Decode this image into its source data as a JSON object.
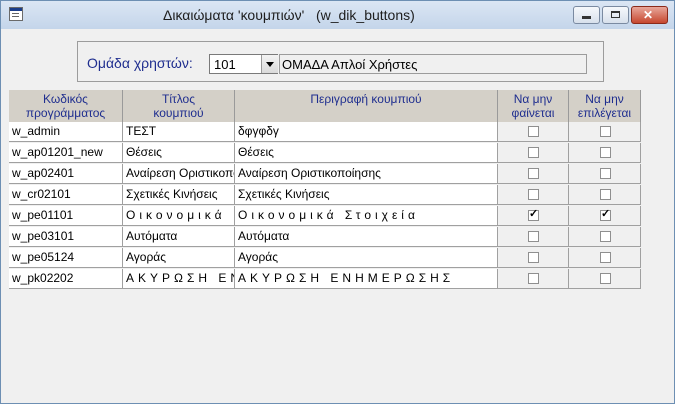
{
  "window": {
    "title": "Δικαιώματα 'κουμπιών'   (w_dik_buttons)",
    "accent": "#1f2e8f"
  },
  "header": {
    "group_label": "Ομάδα χρηστών:",
    "group_code": "101",
    "group_description": "ΟΜΑΔΑ Απλοί Χρήστες"
  },
  "columns": [
    {
      "line1": "Κωδικός",
      "line2": "προγράμματος"
    },
    {
      "line1": "Τίτλος",
      "line2": "κουμπιού"
    },
    {
      "line1": "Περιγραφή κουμπιού",
      "line2": ""
    },
    {
      "line1": "Να μην",
      "line2": "φαίνεται"
    },
    {
      "line1": "Να μην",
      "line2": "επιλέγεται"
    }
  ],
  "rows": [
    {
      "code": "w_admin",
      "title": "ΤΕΣΤ",
      "description": "δφγφδγ",
      "hidden": false,
      "disabled": false,
      "spaced": false
    },
    {
      "code": "w_ap01201_new",
      "title": "Θέσεις",
      "description": "Θέσεις",
      "hidden": false,
      "disabled": false,
      "spaced": false
    },
    {
      "code": "w_ap02401",
      "title": "Αναίρεση Οριστικοποίησης",
      "description": "Αναίρεση Οριστικοποίησης",
      "hidden": false,
      "disabled": false,
      "spaced": false
    },
    {
      "code": "w_cr02101",
      "title": "Σχετικές Κινήσεις",
      "description": "Σχετικές Κινήσεις",
      "hidden": false,
      "disabled": false,
      "spaced": false
    },
    {
      "code": "w_pe01101",
      "title": "Οικονομικά",
      "description": "Οικονομικά Στοιχεία",
      "hidden": true,
      "disabled": true,
      "spaced": true
    },
    {
      "code": "w_pe03101",
      "title": "Αυτόματα",
      "description": "Αυτόματα",
      "hidden": false,
      "disabled": false,
      "spaced": false
    },
    {
      "code": "w_pe05124",
      "title": "Αγοράς",
      "description": "Αγοράς",
      "hidden": false,
      "disabled": false,
      "spaced": false
    },
    {
      "code": "w_pk02202",
      "title": "ΑΚΥΡΩΣΗ ΕΝΗΜΕΡΩΣΗΣ",
      "description": "ΑΚΥΡΩΣΗ  ΕΝΗΜΕΡΩΣΗΣ",
      "hidden": false,
      "disabled": false,
      "spaced": true
    }
  ]
}
